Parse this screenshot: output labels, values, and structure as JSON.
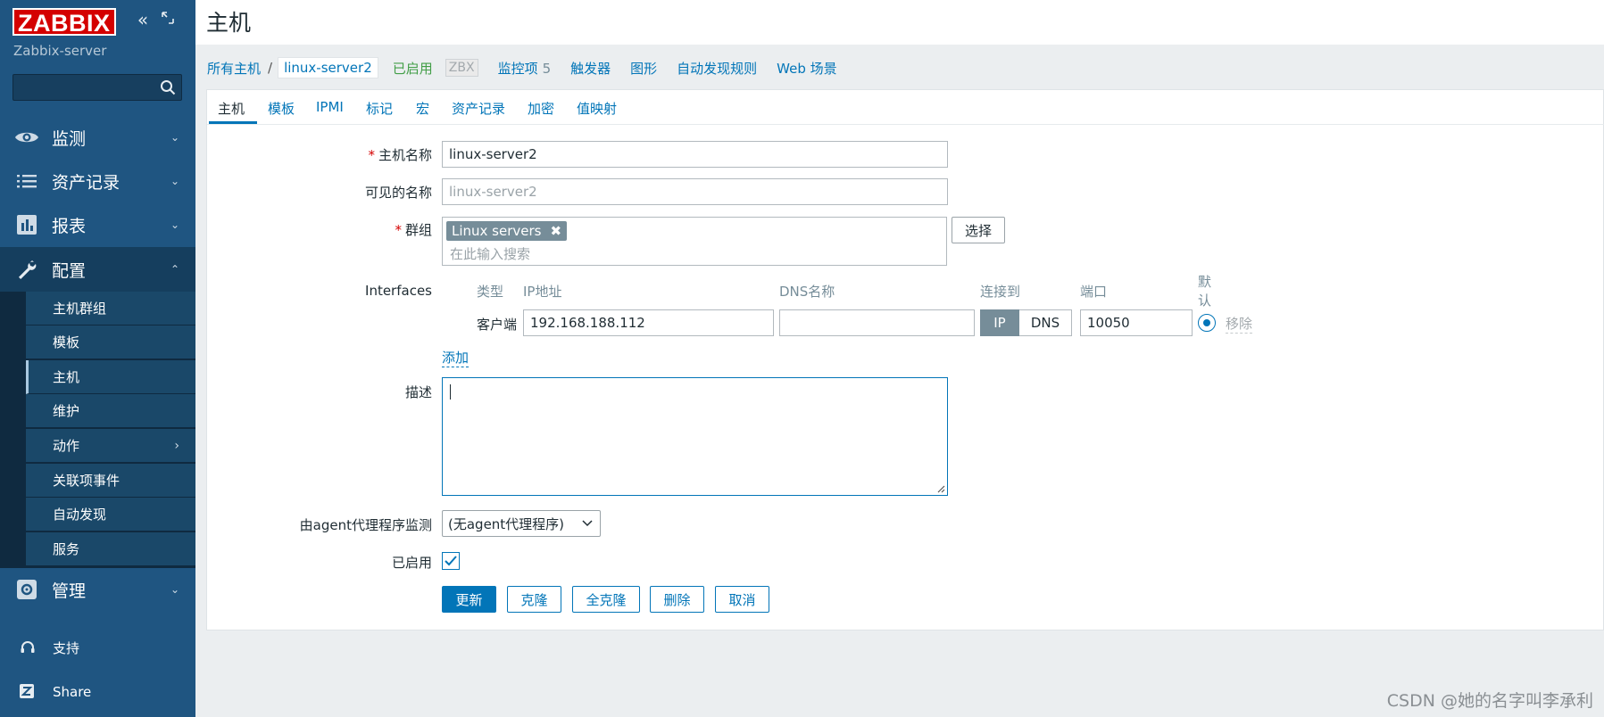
{
  "sidebar": {
    "logo": "ZABBIX",
    "server_name": "Zabbix-server",
    "search_placeholder": "",
    "menu": [
      {
        "label": "监测",
        "icon": "eye-icon"
      },
      {
        "label": "资产记录",
        "icon": "list-icon"
      },
      {
        "label": "报表",
        "icon": "bar-chart-icon"
      },
      {
        "label": "配置",
        "icon": "wrench-icon"
      },
      {
        "label": "管理",
        "icon": "gear-icon"
      }
    ],
    "submenu": [
      "主机群组",
      "模板",
      "主机",
      "维护",
      "动作",
      "关联项事件",
      "自动发现",
      "服务"
    ],
    "bottom": [
      {
        "label": "支持",
        "icon": "headset-icon"
      },
      {
        "label": "Share",
        "icon": "share-icon"
      }
    ]
  },
  "header": {
    "title": "主机"
  },
  "breadcrumb": {
    "all_hosts": "所有主机",
    "separator": "/",
    "current": "linux-server2",
    "status": "已启用",
    "zbx": "ZBX",
    "items_label": "监控项",
    "items_count": "5",
    "triggers": "触发器",
    "graphs": "图形",
    "discovery": "自动发现规则",
    "web": "Web 场景"
  },
  "tabs": [
    "主机",
    "模板",
    "IPMI",
    "标记",
    "宏",
    "资产记录",
    "加密",
    "值映射"
  ],
  "form": {
    "host_name_label": "主机名称",
    "host_name_value": "linux-server2",
    "visible_name_label": "可见的名称",
    "visible_name_placeholder": "linux-server2",
    "groups_label": "群组",
    "group_tag": "Linux servers",
    "groups_placeholder": "在此输入搜索",
    "select_button": "选择",
    "interfaces_label": "Interfaces",
    "interface_headers": {
      "type": "类型",
      "ip": "IP地址",
      "dns": "DNS名称",
      "connect": "连接到",
      "port": "端口",
      "default_line1": "默",
      "default_line2": "认"
    },
    "interface_row": {
      "type": "客户端",
      "ip": "192.168.188.112",
      "dns": "",
      "connect_ip": "IP",
      "connect_dns": "DNS",
      "port": "10050",
      "remove": "移除"
    },
    "add_link": "添加",
    "description_label": "描述",
    "description_value": "",
    "proxy_label": "由agent代理程序监测",
    "proxy_value": "(无agent代理程序)",
    "enabled_label": "已启用",
    "enabled_checked": true,
    "buttons": {
      "update": "更新",
      "clone": "克隆",
      "full_clone": "全克隆",
      "delete": "删除",
      "cancel": "取消"
    }
  },
  "watermark": "CSDN @她的名字叫李承利",
  "colors": {
    "sidebar": "#1f5581",
    "logo_red": "#d40000",
    "link_blue": "#0275b8",
    "enabled_green": "#429e47"
  }
}
